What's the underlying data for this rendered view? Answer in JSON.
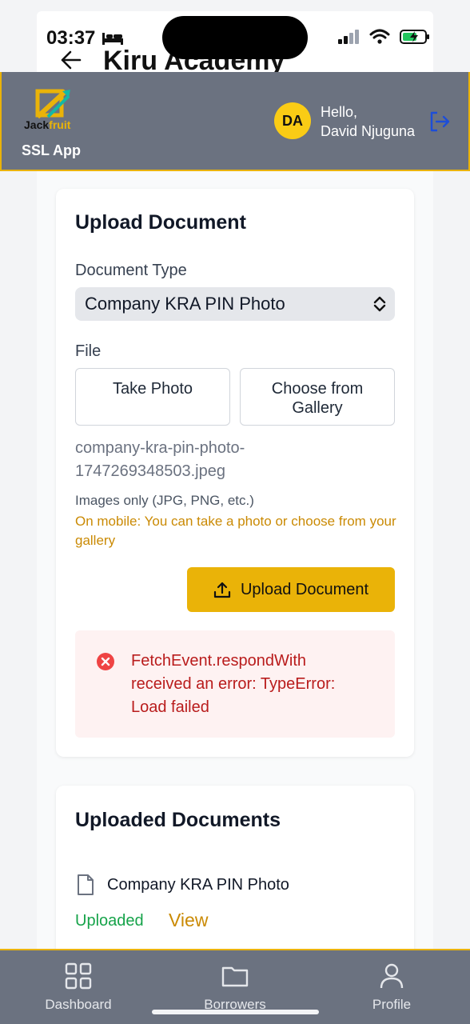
{
  "status_bar": {
    "time": "03:37"
  },
  "behind": {
    "title": "Kiru Academy"
  },
  "header": {
    "logo_text_1": "Jack",
    "logo_text_2": "fruit",
    "app_name": "SSL App",
    "avatar_initials": "DA",
    "greeting_line1": "Hello,",
    "greeting_line2": "David Njuguna"
  },
  "upload_card": {
    "title": "Upload Document",
    "doc_type_label": "Document Type",
    "doc_type_value": "Company KRA PIN Photo",
    "file_label": "File",
    "take_photo": "Take Photo",
    "choose_gallery_line1": "Choose from",
    "choose_gallery_line2": "Gallery",
    "file_name_line1": "company-kra-pin-photo-",
    "file_name_line2": "1747269348503.jpeg",
    "hint": "Images only (JPG, PNG, etc.)",
    "hint_mobile": "On mobile: You can take a photo or choose from your gallery",
    "upload_button": "Upload Document",
    "error_line1": "FetchEvent.respondWith",
    "error_line2": "received an error: TypeError:",
    "error_line3": "Load failed"
  },
  "uploaded_card": {
    "title": "Uploaded Documents",
    "doc_name": "Company KRA PIN Photo",
    "status": "Uploaded",
    "view": "View"
  },
  "nav": {
    "dashboard": "Dashboard",
    "borrowers": "Borrowers",
    "profile": "Profile"
  },
  "colors": {
    "header_bg": "#6b7280",
    "accent": "#eab308",
    "error": "#b91c1c",
    "success": "#16a34a"
  }
}
